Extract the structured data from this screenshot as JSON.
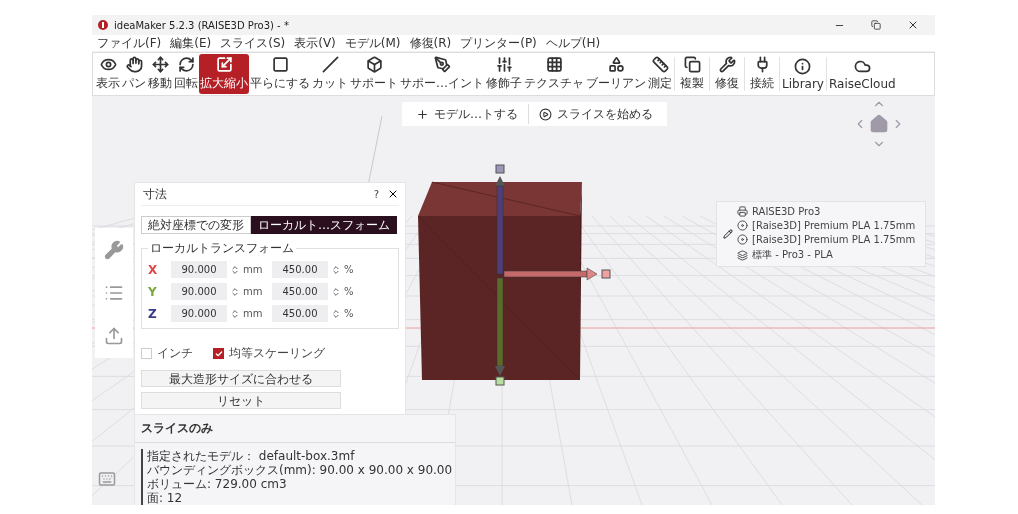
{
  "window": {
    "title": "ideaMaker 5.2.3 (RAISE3D Pro3) - *"
  },
  "menu": [
    "ファイル(F)",
    "編集(E)",
    "スライス(S)",
    "表示(V)",
    "モデル(M)",
    "修復(R)",
    "プリンター(P)",
    "ヘルプ(H)"
  ],
  "toolbar_groups": [
    [
      {
        "label": "表示",
        "selected": false
      },
      {
        "label": "パン",
        "selected": false
      },
      {
        "label": "移動",
        "selected": false
      },
      {
        "label": "回転",
        "selected": false
      },
      {
        "label": "拡大縮小",
        "selected": true
      },
      {
        "label": "平らにする",
        "selected": false
      },
      {
        "label": "カット",
        "selected": false
      },
      {
        "label": "サポート",
        "selected": false
      },
      {
        "label": "サポー…イント",
        "selected": false
      },
      {
        "label": "修飾子",
        "selected": false
      },
      {
        "label": "テクスチャ",
        "selected": false
      },
      {
        "label": "ブーリアン",
        "selected": false
      },
      {
        "label": "測定",
        "selected": false
      }
    ],
    [
      {
        "label": "複製",
        "selected": false
      }
    ],
    [
      {
        "label": "修復",
        "selected": false
      }
    ],
    [
      {
        "label": "接続",
        "selected": false
      }
    ],
    [
      {
        "label": "Library",
        "selected": false
      }
    ],
    [
      {
        "label": "RaiseCloud",
        "selected": false
      }
    ]
  ],
  "actions": [
    {
      "kind": "add",
      "label": "モデル…トする"
    },
    {
      "kind": "play",
      "label": "スライスを始める"
    }
  ],
  "dialog": {
    "title": "寸法",
    "help": "?",
    "tabs": [
      {
        "label": "絶対座標での変形",
        "selected": false
      },
      {
        "label": "ローカルト…スフォーム",
        "selected": true
      }
    ],
    "group": "ローカルトランスフォーム",
    "rows": [
      {
        "axis": "X",
        "color": "#e04848",
        "size": "90.000",
        "size_unit": "mm",
        "scale": "450.00",
        "scale_unit": "%"
      },
      {
        "axis": "Y",
        "color": "#7aa83c",
        "size": "90.000",
        "size_unit": "mm",
        "scale": "450.00",
        "scale_unit": "%"
      },
      {
        "axis": "Z",
        "color": "#3a3a8c",
        "size": "90.000",
        "size_unit": "mm",
        "scale": "450.00",
        "scale_unit": "%"
      }
    ],
    "checkboxes": [
      {
        "label": "インチ",
        "checked": false
      },
      {
        "label": "均等スケーリング",
        "checked": true
      }
    ],
    "buttons": [
      "最大造形サイズに合わせる",
      "リセット"
    ]
  },
  "info": {
    "title": "スライスのみ",
    "lines": [
      "指定されたモデル： default-box.3mf",
      "バウンディングボックス(mm): 90.00 x 90.00 x 90.00",
      "ボリューム: 729.00 cm3",
      "面: 12"
    ]
  },
  "printer_panel": [
    {
      "kind": "printer",
      "label": "RAISE3D Pro3"
    },
    {
      "kind": "left",
      "label": "[Raise3D] Premium PLA 1.75mm"
    },
    {
      "kind": "right",
      "label": "[Raise3D] Premium PLA 1.75mm"
    },
    {
      "kind": "profile",
      "label": "標準 - Pro3 - PLA"
    }
  ]
}
